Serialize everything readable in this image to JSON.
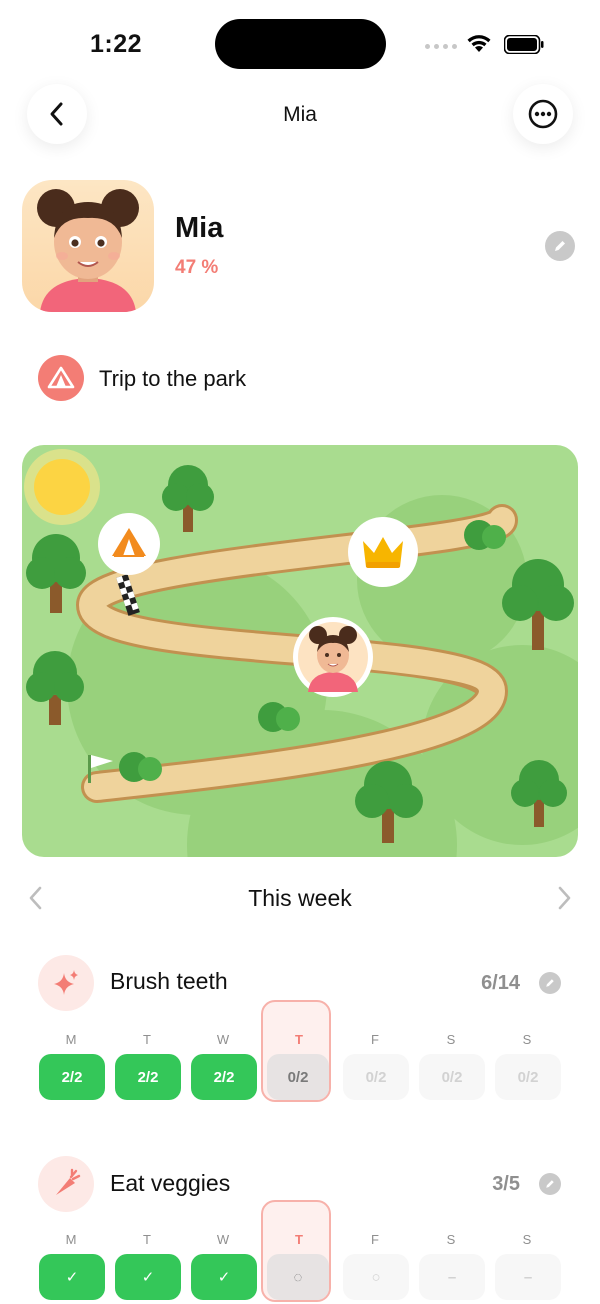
{
  "status": {
    "time": "1:22"
  },
  "nav": {
    "title": "Mia"
  },
  "profile": {
    "name": "Mia",
    "progress": "47 %"
  },
  "goal": {
    "label": "Trip to the park"
  },
  "map": {
    "progress_fraction": 0.47
  },
  "week": {
    "title": "This week"
  },
  "colors": {
    "accent": "#f37d75",
    "done": "#34c759",
    "map_grass": "#a9dc8f",
    "path": "#efd39c"
  },
  "habits": [
    {
      "name": "Brush teeth",
      "count": "6/14",
      "icon": "sparkles-icon",
      "days": [
        {
          "letter": "M",
          "value": "2/2",
          "state": "done"
        },
        {
          "letter": "T",
          "value": "2/2",
          "state": "done"
        },
        {
          "letter": "W",
          "value": "2/2",
          "state": "done"
        },
        {
          "letter": "T",
          "value": "0/2",
          "state": "today"
        },
        {
          "letter": "F",
          "value": "0/2",
          "state": "future"
        },
        {
          "letter": "S",
          "value": "0/2",
          "state": "future"
        },
        {
          "letter": "S",
          "value": "0/2",
          "state": "future"
        }
      ]
    },
    {
      "name": "Eat veggies",
      "count": "3/5",
      "icon": "carrot-icon",
      "days": [
        {
          "letter": "M",
          "value": "✓",
          "state": "done"
        },
        {
          "letter": "T",
          "value": "✓",
          "state": "done"
        },
        {
          "letter": "W",
          "value": "✓",
          "state": "done"
        },
        {
          "letter": "T",
          "value": "◌",
          "state": "today"
        },
        {
          "letter": "F",
          "value": "○",
          "state": "future"
        },
        {
          "letter": "S",
          "value": "–",
          "state": "future"
        },
        {
          "letter": "S",
          "value": "–",
          "state": "future"
        }
      ]
    }
  ]
}
